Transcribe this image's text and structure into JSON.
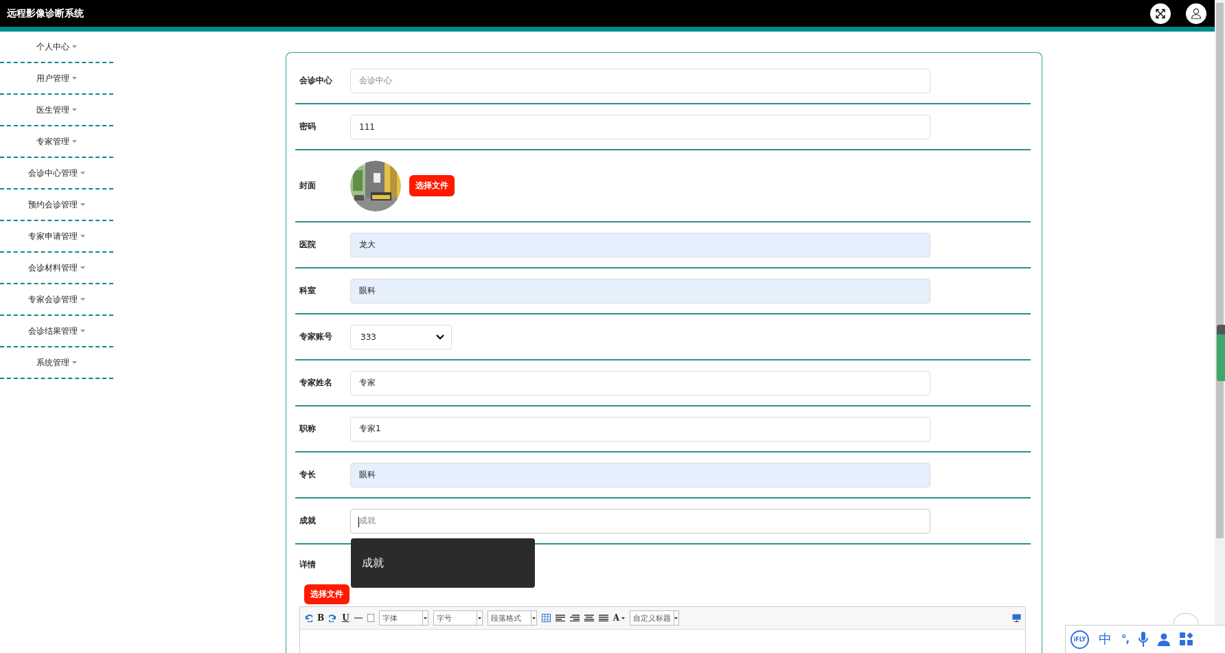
{
  "app": {
    "title": "远程影像诊断系统"
  },
  "sidebar": {
    "items": [
      {
        "label": "个人中心"
      },
      {
        "label": "用户管理"
      },
      {
        "label": "医生管理"
      },
      {
        "label": "专家管理"
      },
      {
        "label": "会诊中心管理"
      },
      {
        "label": "预约会诊管理"
      },
      {
        "label": "专家申请管理"
      },
      {
        "label": "会诊材料管理"
      },
      {
        "label": "专家会诊管理"
      },
      {
        "label": "会诊结果管理"
      },
      {
        "label": "系统管理"
      }
    ]
  },
  "form": {
    "fields": [
      {
        "kind": "text",
        "label": "会诊中心",
        "placeholder": "会诊中心",
        "readonly": false,
        "focused": false
      },
      {
        "kind": "text",
        "label": "密码",
        "value": "111",
        "readonly": false,
        "focused": false
      },
      {
        "label": "封面",
        "button": "选择文件"
      },
      {
        "kind": "text",
        "label": "医院",
        "value": "龙大",
        "readonly": true,
        "focused": false
      },
      {
        "kind": "text",
        "label": "科室",
        "value": "眼科",
        "readonly": true,
        "focused": false
      },
      {
        "kind": "select",
        "label": "专家账号",
        "value": "333"
      },
      {
        "kind": "text",
        "label": "专家姓名",
        "value": "专家",
        "readonly": false,
        "focused": false
      },
      {
        "kind": "text",
        "label": "职称",
        "value": "专家1",
        "readonly": false,
        "focused": false
      },
      {
        "kind": "text",
        "label": "专长",
        "value": "眼科",
        "readonly": true,
        "focused": false
      },
      {
        "kind": "text",
        "label": "成就",
        "placeholder": "成就",
        "readonly": false,
        "focused": true
      },
      {
        "kind": "editor",
        "label": "详情",
        "button": "选择文件",
        "toolbar": {
          "bold": "B",
          "underline": "U",
          "text_color": "A",
          "selects": [
            "字体",
            "字号",
            "段落格式",
            "自定义标题"
          ]
        }
      }
    ]
  },
  "tooltip": {
    "text": "成就"
  },
  "ime_bar": {
    "logo": "iFLY",
    "mode": "中",
    "punctuation": "°,"
  }
}
